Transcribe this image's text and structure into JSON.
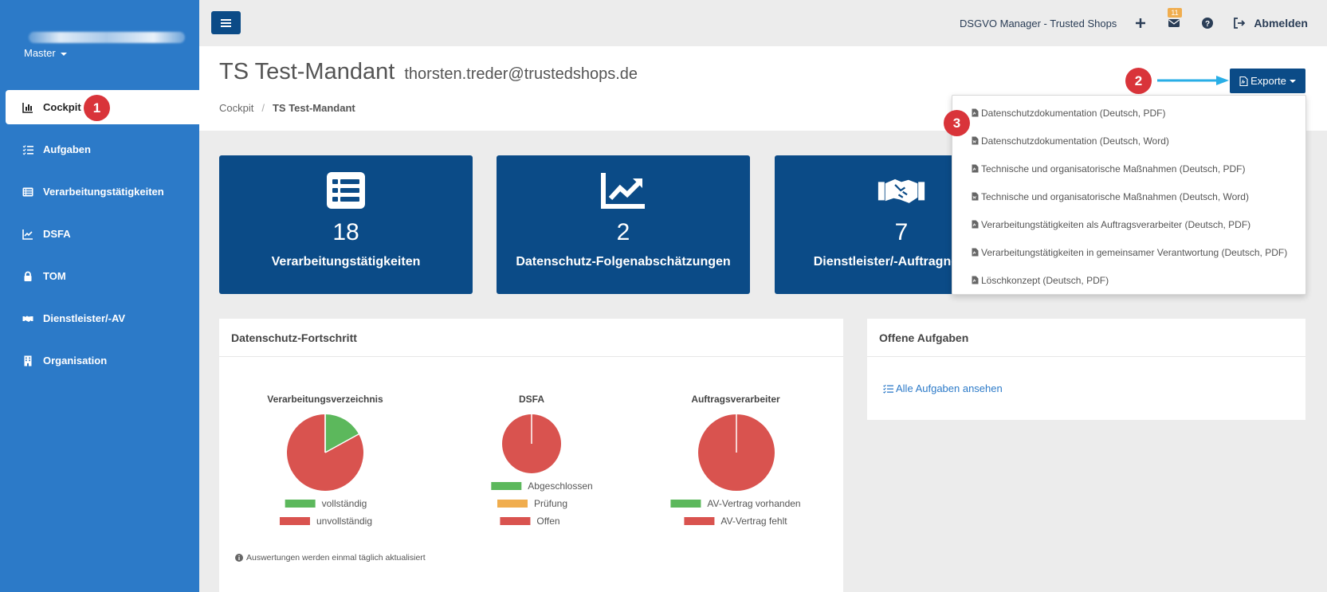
{
  "sidebar": {
    "master_label": "Master",
    "items": [
      {
        "label": "Cockpit",
        "icon": "bar-chart-icon",
        "active": true
      },
      {
        "label": "Aufgaben",
        "icon": "tasks-icon"
      },
      {
        "label": "Verarbeitungstätigkeiten",
        "icon": "list-icon"
      },
      {
        "label": "DSFA",
        "icon": "line-chart-icon"
      },
      {
        "label": "TOM",
        "icon": "lock-icon"
      },
      {
        "label": "Dienstleister/-AV",
        "icon": "handshake-icon"
      },
      {
        "label": "Organisation",
        "icon": "building-icon"
      }
    ]
  },
  "markers": {
    "one": "1",
    "two": "2",
    "three": "3"
  },
  "topbar": {
    "app_name": "DSGVO Manager - Trusted Shops",
    "mail_count": "11",
    "logout_label": "Abmelden"
  },
  "header": {
    "title": "TS Test-Mandant",
    "email": "thorsten.treder@trustedshops.de",
    "breadcrumb": [
      "Cockpit",
      "TS Test-Mandant"
    ]
  },
  "exports": {
    "button_label": "Exporte",
    "items": [
      "Datenschutzdokumentation (Deutsch, PDF)",
      "Datenschutzdokumentation (Deutsch, Word)",
      "Technische und organisatorische Maßnahmen (Deutsch, PDF)",
      "Technische und organisatorische Maßnahmen (Deutsch, Word)",
      "Verarbeitungstätigkeiten als Auftragsverarbeiter (Deutsch, PDF)",
      "Verarbeitungstätigkeiten in gemeinsamer Verantwortung (Deutsch, PDF)",
      "Löschkonzept (Deutsch, PDF)"
    ]
  },
  "tiles": [
    {
      "value": "18",
      "label": "Verarbeitungstätigkeiten",
      "icon": "list-icon"
    },
    {
      "value": "2",
      "label": "Datenschutz-Folgenabschätzungen",
      "icon": "line-chart-icon"
    },
    {
      "value": "7",
      "label": "Dienstleister/-Auftragnehmer",
      "icon": "handshake-icon"
    }
  ],
  "progress_panel": {
    "title": "Datenschutz-Fortschritt",
    "note": "Auswertungen werden einmal täglich aktualisiert"
  },
  "tasks_panel": {
    "title": "Offene Aufgaben",
    "link_label": "Alle Aufgaben ansehen"
  },
  "colors": {
    "green": "#5cb85c",
    "orange": "#f0ad4e",
    "red": "#d9534f",
    "primary": "#0b4b87",
    "sidebar": "#2c7ac8"
  },
  "chart_data": [
    {
      "type": "pie",
      "title": "Verarbeitungsverzeichnis",
      "categories": [
        "vollständig",
        "unvollständig"
      ],
      "values": [
        17,
        83
      ],
      "colors": [
        "#5cb85c",
        "#d9534f"
      ]
    },
    {
      "type": "pie",
      "title": "DSFA",
      "categories": [
        "Abgeschlossen",
        "Prüfung",
        "Offen"
      ],
      "values": [
        0,
        0,
        100
      ],
      "colors": [
        "#5cb85c",
        "#f0ad4e",
        "#d9534f"
      ]
    },
    {
      "type": "pie",
      "title": "Auftragsverarbeiter",
      "categories": [
        "AV-Vertrag vorhanden",
        "AV-Vertrag fehlt"
      ],
      "values": [
        0,
        100
      ],
      "colors": [
        "#5cb85c",
        "#d9534f"
      ]
    }
  ]
}
